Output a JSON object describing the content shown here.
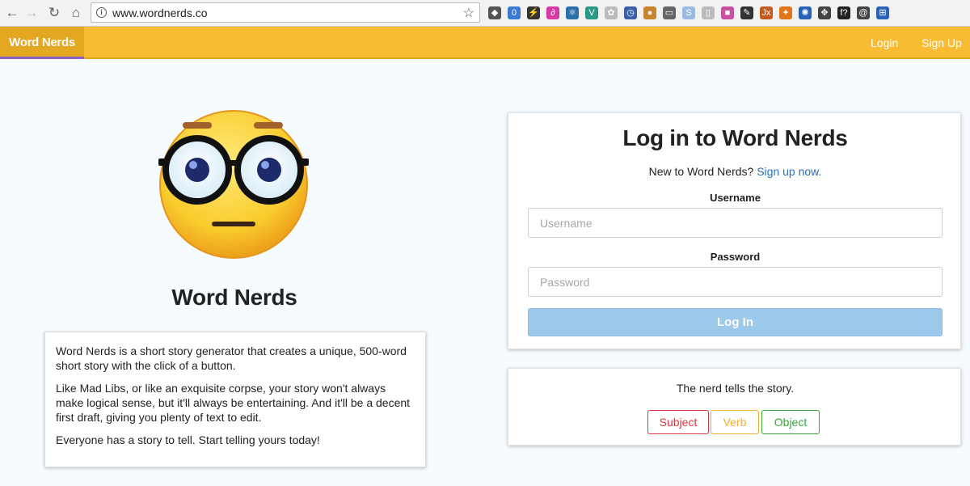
{
  "browser": {
    "url": "www.wordnerds.co",
    "back_glyph": "←",
    "forward_glyph": "→",
    "reload_glyph": "↻",
    "home_glyph": "⌂",
    "star_glyph": "☆",
    "info_glyph": "i",
    "extensions": [
      {
        "name": "pocket-icon",
        "color": "#555555",
        "glyph": "◆"
      },
      {
        "name": "ghostery-icon",
        "color": "#3b7bd6",
        "glyph": "0"
      },
      {
        "name": "bolt-icon",
        "color": "#333333",
        "glyph": "⚡"
      },
      {
        "name": "swirl-icon",
        "color": "#d63aa3",
        "glyph": "∂"
      },
      {
        "name": "react-icon",
        "color": "#2b6fa8",
        "glyph": "⚛"
      },
      {
        "name": "vue-icon",
        "color": "#2a9a87",
        "glyph": "V"
      },
      {
        "name": "leaf-icon",
        "color": "#bbbbbb",
        "glyph": "✿"
      },
      {
        "name": "clock-icon",
        "color": "#3c5fa8",
        "glyph": "◷"
      },
      {
        "name": "cookie-icon",
        "color": "#c9842f",
        "glyph": "●"
      },
      {
        "name": "cast-icon",
        "color": "#666666",
        "glyph": "▭"
      },
      {
        "name": "skype-icon",
        "color": "#9abbe0",
        "glyph": "S"
      },
      {
        "name": "page-icon",
        "color": "#bbbbbb",
        "glyph": "▯"
      },
      {
        "name": "gradient-icon",
        "color": "#c94fa0",
        "glyph": "■"
      },
      {
        "name": "eyedropper-icon",
        "color": "#333333",
        "glyph": "✎"
      },
      {
        "name": "jsx-icon",
        "color": "#c35b1f",
        "glyph": "Jx"
      },
      {
        "name": "metamask-icon",
        "color": "#e2761b",
        "glyph": "✦"
      },
      {
        "name": "settings-badge-icon",
        "color": "#2a62b5",
        "glyph": "✺"
      },
      {
        "name": "move-icon",
        "color": "#444444",
        "glyph": "✥"
      },
      {
        "name": "function-icon",
        "color": "#222222",
        "glyph": "f?"
      },
      {
        "name": "at-icon",
        "color": "#444444",
        "glyph": "@"
      },
      {
        "name": "frame-icon",
        "color": "#2a62b5",
        "glyph": "⊞"
      }
    ]
  },
  "navbar": {
    "brand": "Word Nerds",
    "login": "Login",
    "signup": "Sign Up"
  },
  "hero": {
    "title": "Word Nerds",
    "paragraphs": [
      "Word Nerds is a short story generator that creates a unique, 500-word short story with the click of a button.",
      "Like Mad Libs, or like an exquisite corpse, your story won't always make logical sense, but it'll always be entertaining. And it'll be a decent first draft, giving you plenty of text to edit.",
      "Everyone has a story to tell. Start telling yours today!"
    ]
  },
  "login": {
    "title": "Log in to Word Nerds",
    "prompt": "New to Word Nerds?",
    "signup_link": "Sign up now.",
    "username_label": "Username",
    "username_placeholder": "Username",
    "password_label": "Password",
    "password_placeholder": "Password",
    "submit": "Log In"
  },
  "tagline": {
    "text": "The nerd tells the story.",
    "buttons": [
      {
        "label": "Subject",
        "color": "#d9363e"
      },
      {
        "label": "Verb",
        "color": "#f0b232"
      },
      {
        "label": "Object",
        "color": "#3aa53a"
      }
    ]
  }
}
